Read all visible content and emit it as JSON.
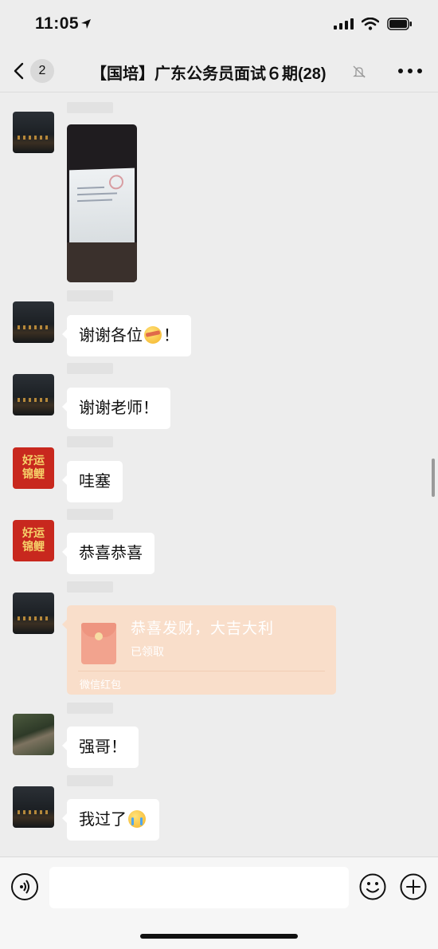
{
  "status_bar": {
    "time": "11:05"
  },
  "nav": {
    "back_count": "2",
    "title": "【国培】广东公务员面试６期(28)"
  },
  "messages": [
    {
      "type": "image",
      "avatar": "night-town"
    },
    {
      "type": "text",
      "avatar": "night-town",
      "text": "谢谢各位",
      "emoji": "bandage-face",
      "suffix": "！"
    },
    {
      "type": "text",
      "avatar": "night-town",
      "text": "谢谢老师！"
    },
    {
      "type": "text",
      "avatar": "koi-red",
      "avatar_text": [
        "好运",
        "锦鲤"
      ],
      "text": "哇塞"
    },
    {
      "type": "text",
      "avatar": "koi-red",
      "avatar_text": [
        "好运",
        "锦鲤"
      ],
      "text": "恭喜恭喜"
    },
    {
      "type": "red_packet",
      "avatar": "night-town",
      "title": "恭喜发财，大吉大利",
      "status": "已领取",
      "label": "微信红包"
    },
    {
      "type": "text",
      "avatar": "photo",
      "text": "强哥！"
    },
    {
      "type": "text",
      "avatar": "night-town",
      "text": "我过了",
      "emoji": "crying-face"
    }
  ],
  "input": {
    "placeholder": "",
    "value": ""
  },
  "icons": {
    "back": "chevron-left-icon",
    "mute": "bell-slash-icon",
    "more": "ellipsis-icon",
    "voice": "voice-icon",
    "emoji": "smiley-icon",
    "plus": "plus-circle-icon"
  },
  "colors": {
    "background": "#ededed",
    "bubble": "#ffffff",
    "red_packet": "#f9deca"
  }
}
